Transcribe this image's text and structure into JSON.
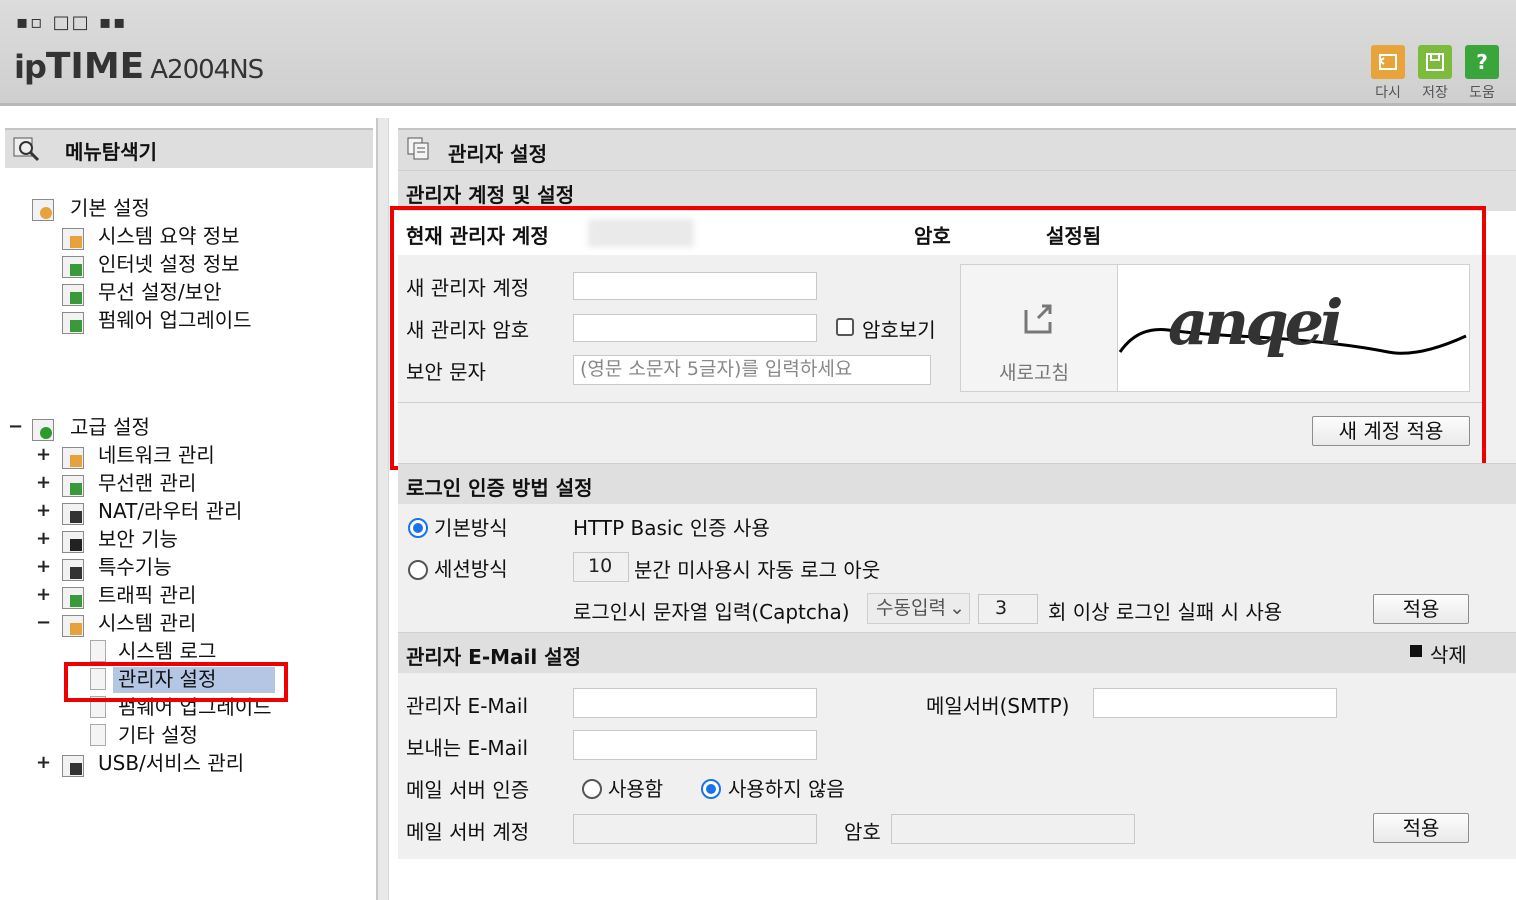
{
  "header": {
    "logo_dots": "▪▫□□▪▪",
    "brand_prefix": "ip",
    "brand_main": "TIME",
    "model": "A2004NS",
    "toolbar": [
      {
        "label": "다시",
        "icon": "undo-icon",
        "color": "#e8a33a"
      },
      {
        "label": "저장",
        "icon": "save-icon",
        "color": "#7dbb3c"
      },
      {
        "label": "도움",
        "icon": "help-icon",
        "color": "#3aa53a"
      }
    ]
  },
  "sidebar": {
    "title": "메뉴탐색기",
    "basic": {
      "label": "기본 설정",
      "items": [
        "시스템 요약 정보",
        "인터넷 설정 정보",
        "무선 설정/보안",
        "펌웨어 업그레이드"
      ]
    },
    "advanced": {
      "collapse_symbol": "−",
      "label": "고급 설정",
      "items": [
        {
          "label": "네트워크 관리",
          "symbol": "+"
        },
        {
          "label": "무선랜 관리",
          "symbol": "+"
        },
        {
          "label": "NAT/라우터 관리",
          "symbol": "+"
        },
        {
          "label": "보안 기능",
          "symbol": "+"
        },
        {
          "label": "특수기능",
          "symbol": "+"
        },
        {
          "label": "트래픽 관리",
          "symbol": "+"
        },
        {
          "label": "시스템 관리",
          "symbol": "−"
        }
      ],
      "system_children": [
        "시스템 로그",
        "관리자 설정",
        "펌웨어 업그레이드",
        "기타 설정"
      ],
      "last": {
        "label": "USB/서비스 관리",
        "symbol": "+"
      }
    }
  },
  "main": {
    "title": "관리자 설정",
    "account": {
      "section_title": "관리자 계정 및 설정",
      "current_label": "현재 관리자 계정",
      "password_label": "암호",
      "password_status": "설정됨",
      "new_account_label": "새 관리자 계정",
      "new_password_label": "새 관리자 암호",
      "show_password_label": "암호보기",
      "captcha_label": "보안 문자",
      "captcha_placeholder": "(영문 소문자 5글자)를 입력하세요",
      "refresh_label": "새로고침",
      "captcha_text": "anqei",
      "apply_button": "새 계정 적용"
    },
    "login": {
      "section_title": "로그인 인증 방법 설정",
      "basic_label": "기본방식",
      "basic_desc": "HTTP Basic 인증 사용",
      "session_label": "세션방식",
      "session_minutes": "10",
      "session_desc": "분간 미사용시 자동 로그 아웃",
      "captcha_label": "로그인시 문자열 입력(Captcha)",
      "captcha_mode": "수동입력",
      "fail_count": "3",
      "fail_desc": "회 이상 로그인 실패 시 사용",
      "apply_button": "적용"
    },
    "email": {
      "section_title": "관리자 E-Mail 설정",
      "delete_label": "삭제",
      "admin_email_label": "관리자 E-Mail",
      "smtp_label": "메일서버(SMTP)",
      "sender_label": "보내는 E-Mail",
      "auth_label": "메일 서버 인증",
      "auth_on": "사용함",
      "auth_off": "사용하지 않음",
      "account_label": "메일 서버 계정",
      "password_label": "암호",
      "apply_button": "적용"
    }
  },
  "colors": {
    "highlight": "#e00000",
    "selected": "#b4c6e4",
    "radio": "#1a73e8"
  }
}
